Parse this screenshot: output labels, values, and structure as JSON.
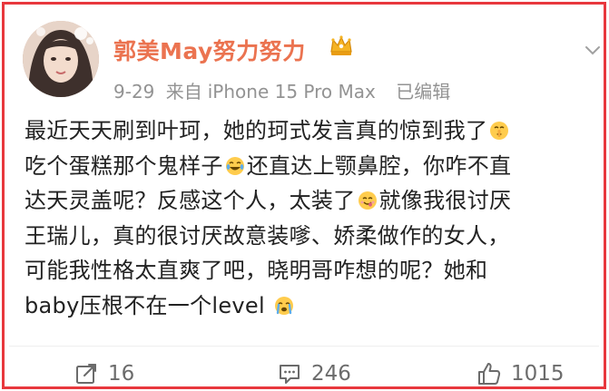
{
  "post": {
    "author": {
      "name": "郭美May努力努力",
      "avatar_icon": "avatar-photo",
      "badge_icon": "vip-crown-icon"
    },
    "meta": {
      "date": "9-29",
      "source_prefix": "来自",
      "device": "iPhone 15 Pro Max",
      "edited": "已编辑"
    },
    "lines": [
      {
        "parts": [
          {
            "text": "最近天天刷到叶珂，她的珂式发言真的惊到我了"
          }
        ],
        "emoji": "shush-face"
      },
      {
        "parts": [
          {
            "text": "吃个蛋糕那个鬼样子"
          }
        ],
        "emoji_mid": "laugh-tears-face",
        "after": "还直达上颚鼻腔，你咋不直"
      },
      {
        "parts": [
          {
            "text": "达天灵盖呢？反感这个人，太装了"
          }
        ],
        "emoji_mid": "yum-face",
        "after": "就像我很讨厌"
      },
      {
        "parts": [
          {
            "text": "王瑞儿，真的很讨厌故意装嗲、娇柔做作的女人，"
          }
        ]
      },
      {
        "parts": [
          {
            "text": "可能我性格太直爽了吧，晓明哥咋想的呢？她和"
          }
        ]
      },
      {
        "parts": [
          {
            "text": "baby压根不在一个level"
          }
        ],
        "emoji": "crying-face"
      }
    ],
    "actions": {
      "repost_count": "16",
      "comment_count": "246",
      "like_count": "1015"
    }
  },
  "colors": {
    "frame_border": "#e8383d",
    "username": "#eb7350",
    "meta_text": "#939393",
    "body_text": "#222222",
    "action_text": "#6b6b6b"
  }
}
